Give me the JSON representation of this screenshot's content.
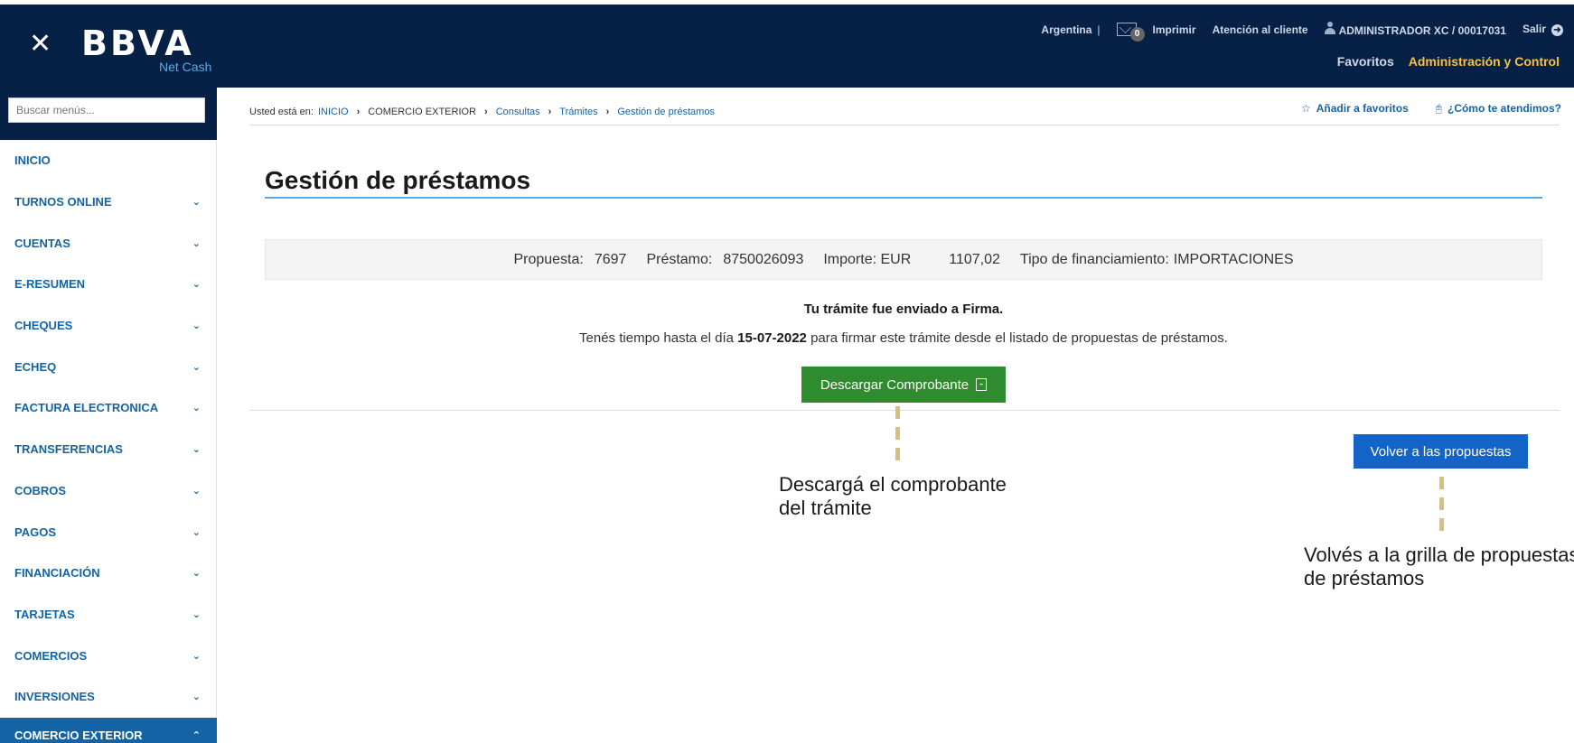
{
  "header": {
    "logo": "BBVA",
    "logo_sub": "Net Cash",
    "country": "Argentina",
    "mail_count": "0",
    "print": "Imprimir",
    "support": "Atención al cliente",
    "user": "ADMINISTRADOR XC / 00017031",
    "logout": "Salir",
    "favorites": "Favoritos",
    "admin": "Administración y Control"
  },
  "sidebar": {
    "search_placeholder": "Buscar menús...",
    "items": [
      {
        "label": "INICIO"
      },
      {
        "label": "TURNOS ONLINE"
      },
      {
        "label": "CUENTAS"
      },
      {
        "label": "E-RESUMEN"
      },
      {
        "label": "CHEQUES"
      },
      {
        "label": "ECHEQ"
      },
      {
        "label": "FACTURA ELECTRONICA"
      },
      {
        "label": "TRANSFERENCIAS"
      },
      {
        "label": "COBROS"
      },
      {
        "label": "PAGOS"
      },
      {
        "label": "FINANCIACIÓN"
      },
      {
        "label": "TARJETAS"
      },
      {
        "label": "COMERCIOS"
      },
      {
        "label": "INVERSIONES"
      },
      {
        "label": "COMERCIO EXTERIOR"
      }
    ]
  },
  "breadcrumb": {
    "prefix": "Usted está en:",
    "items": [
      "INICIO",
      "COMERCIO EXTERIOR",
      "Consultas",
      "Trámites",
      "Gestión de préstamos"
    ]
  },
  "tools": {
    "add_favorites": "Añadir a favoritos",
    "help": "¿Cómo te atendimos?"
  },
  "main": {
    "title": "Gestión de préstamos",
    "proposal_label": "Propuesta:",
    "proposal_value": "7697",
    "loan_label": "Préstamo:",
    "loan_value": "8750026093",
    "amount_label": "Importe: EUR",
    "amount_value": "1107,02",
    "financing_label": "Tipo de financiamiento:",
    "financing_value": "IMPORTACIONES",
    "message_title": "Tu trámite fue enviado a Firma.",
    "message_pre": "Tenés tiempo hasta el día",
    "message_date": "15-07-2022",
    "message_post": "para firmar este trámite desde el listado de propuestas de préstamos.",
    "download_button": "Descargar Comprobante",
    "back_button": "Volver a las propuestas"
  },
  "annotations": {
    "download_line1": "Descargá el comprobante",
    "download_line2": "del trámite",
    "back_line1": "Volvés a la grilla de propuestas",
    "back_line2": "de préstamos"
  },
  "colors": {
    "header_bg": "#072146",
    "accent_blue": "#1464a5",
    "download_green": "#2e8b2e",
    "admin_yellow": "#f5c242",
    "annotation_dash": "#d9be7c"
  }
}
